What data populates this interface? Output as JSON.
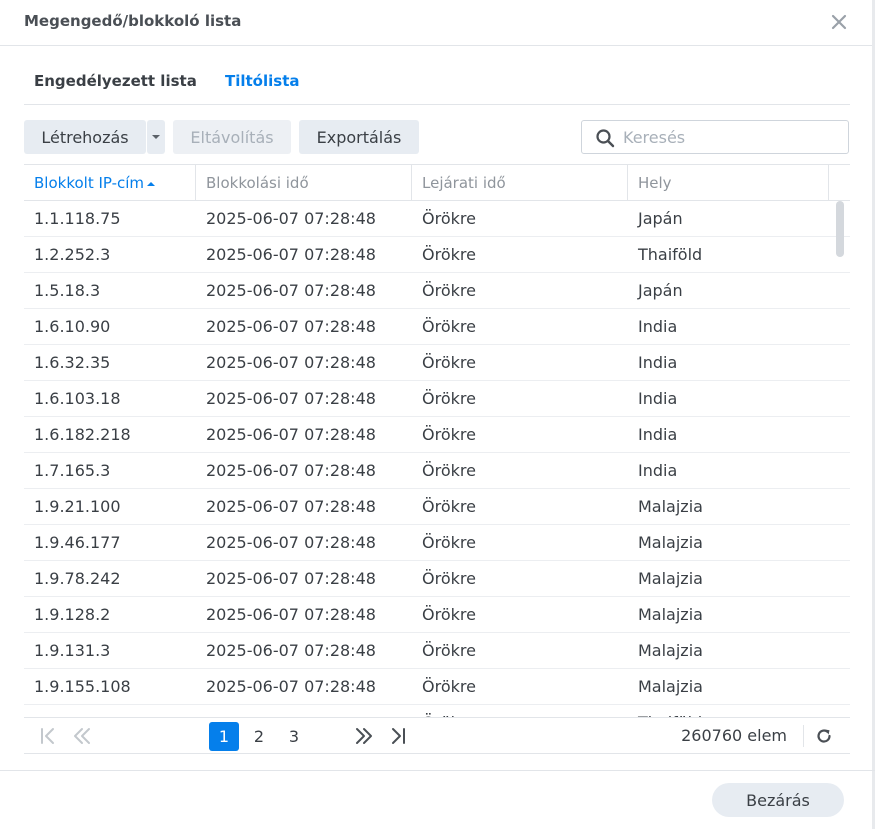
{
  "window": {
    "title": "Megengedő/blokkoló lista"
  },
  "tabs": [
    {
      "label": "Engedélyezett lista",
      "active": false
    },
    {
      "label": "Tiltólista",
      "active": true
    }
  ],
  "toolbar": {
    "create_label": "Létrehozás",
    "remove_label": "Eltávolítás",
    "export_label": "Exportálás",
    "search_placeholder": "Keresés"
  },
  "table": {
    "columns": [
      "Blokkolt IP-cím",
      "Blokkolási idő",
      "Lejárati idő",
      "Hely"
    ],
    "sort_column": "Blokkolt IP-cím",
    "rows": [
      {
        "ip": "1.1.118.75",
        "time": "2025-06-07 07:28:48",
        "expires": "Örökre",
        "location": "Japán"
      },
      {
        "ip": "1.2.252.3",
        "time": "2025-06-07 07:28:48",
        "expires": "Örökre",
        "location": "Thaiföld"
      },
      {
        "ip": "1.5.18.3",
        "time": "2025-06-07 07:28:48",
        "expires": "Örökre",
        "location": "Japán"
      },
      {
        "ip": "1.6.10.90",
        "time": "2025-06-07 07:28:48",
        "expires": "Örökre",
        "location": "India"
      },
      {
        "ip": "1.6.32.35",
        "time": "2025-06-07 07:28:48",
        "expires": "Örökre",
        "location": "India"
      },
      {
        "ip": "1.6.103.18",
        "time": "2025-06-07 07:28:48",
        "expires": "Örökre",
        "location": "India"
      },
      {
        "ip": "1.6.182.218",
        "time": "2025-06-07 07:28:48",
        "expires": "Örökre",
        "location": "India"
      },
      {
        "ip": "1.7.165.3",
        "time": "2025-06-07 07:28:48",
        "expires": "Örökre",
        "location": "India"
      },
      {
        "ip": "1.9.21.100",
        "time": "2025-06-07 07:28:48",
        "expires": "Örökre",
        "location": "Malajzia"
      },
      {
        "ip": "1.9.46.177",
        "time": "2025-06-07 07:28:48",
        "expires": "Örökre",
        "location": "Malajzia"
      },
      {
        "ip": "1.9.78.242",
        "time": "2025-06-07 07:28:48",
        "expires": "Örökre",
        "location": "Malajzia"
      },
      {
        "ip": "1.9.128.2",
        "time": "2025-06-07 07:28:48",
        "expires": "Örökre",
        "location": "Malajzia"
      },
      {
        "ip": "1.9.131.3",
        "time": "2025-06-07 07:28:48",
        "expires": "Örökre",
        "location": "Malajzia"
      },
      {
        "ip": "1.9.155.108",
        "time": "2025-06-07 07:28:48",
        "expires": "Örökre",
        "location": "Malajzia"
      },
      {
        "ip": "",
        "time": "",
        "expires": "Örökre",
        "location": "Thaiföld"
      }
    ]
  },
  "pagination": {
    "pages": [
      "1",
      "2",
      "3"
    ],
    "current_page": "1",
    "total_label": "260760 elem"
  },
  "footer": {
    "close_label": "Bezárás"
  },
  "colors": {
    "accent": "#057feb",
    "button_bg": "#e7ecf2",
    "text": "#3a3f45",
    "muted": "#a8b0b9"
  },
  "icons": [
    "close-icon",
    "dropdown-caret-icon",
    "search-icon",
    "sort-ascending-icon",
    "first-page-icon",
    "previous-page-icon",
    "next-page-icon",
    "last-page-icon",
    "refresh-icon"
  ]
}
